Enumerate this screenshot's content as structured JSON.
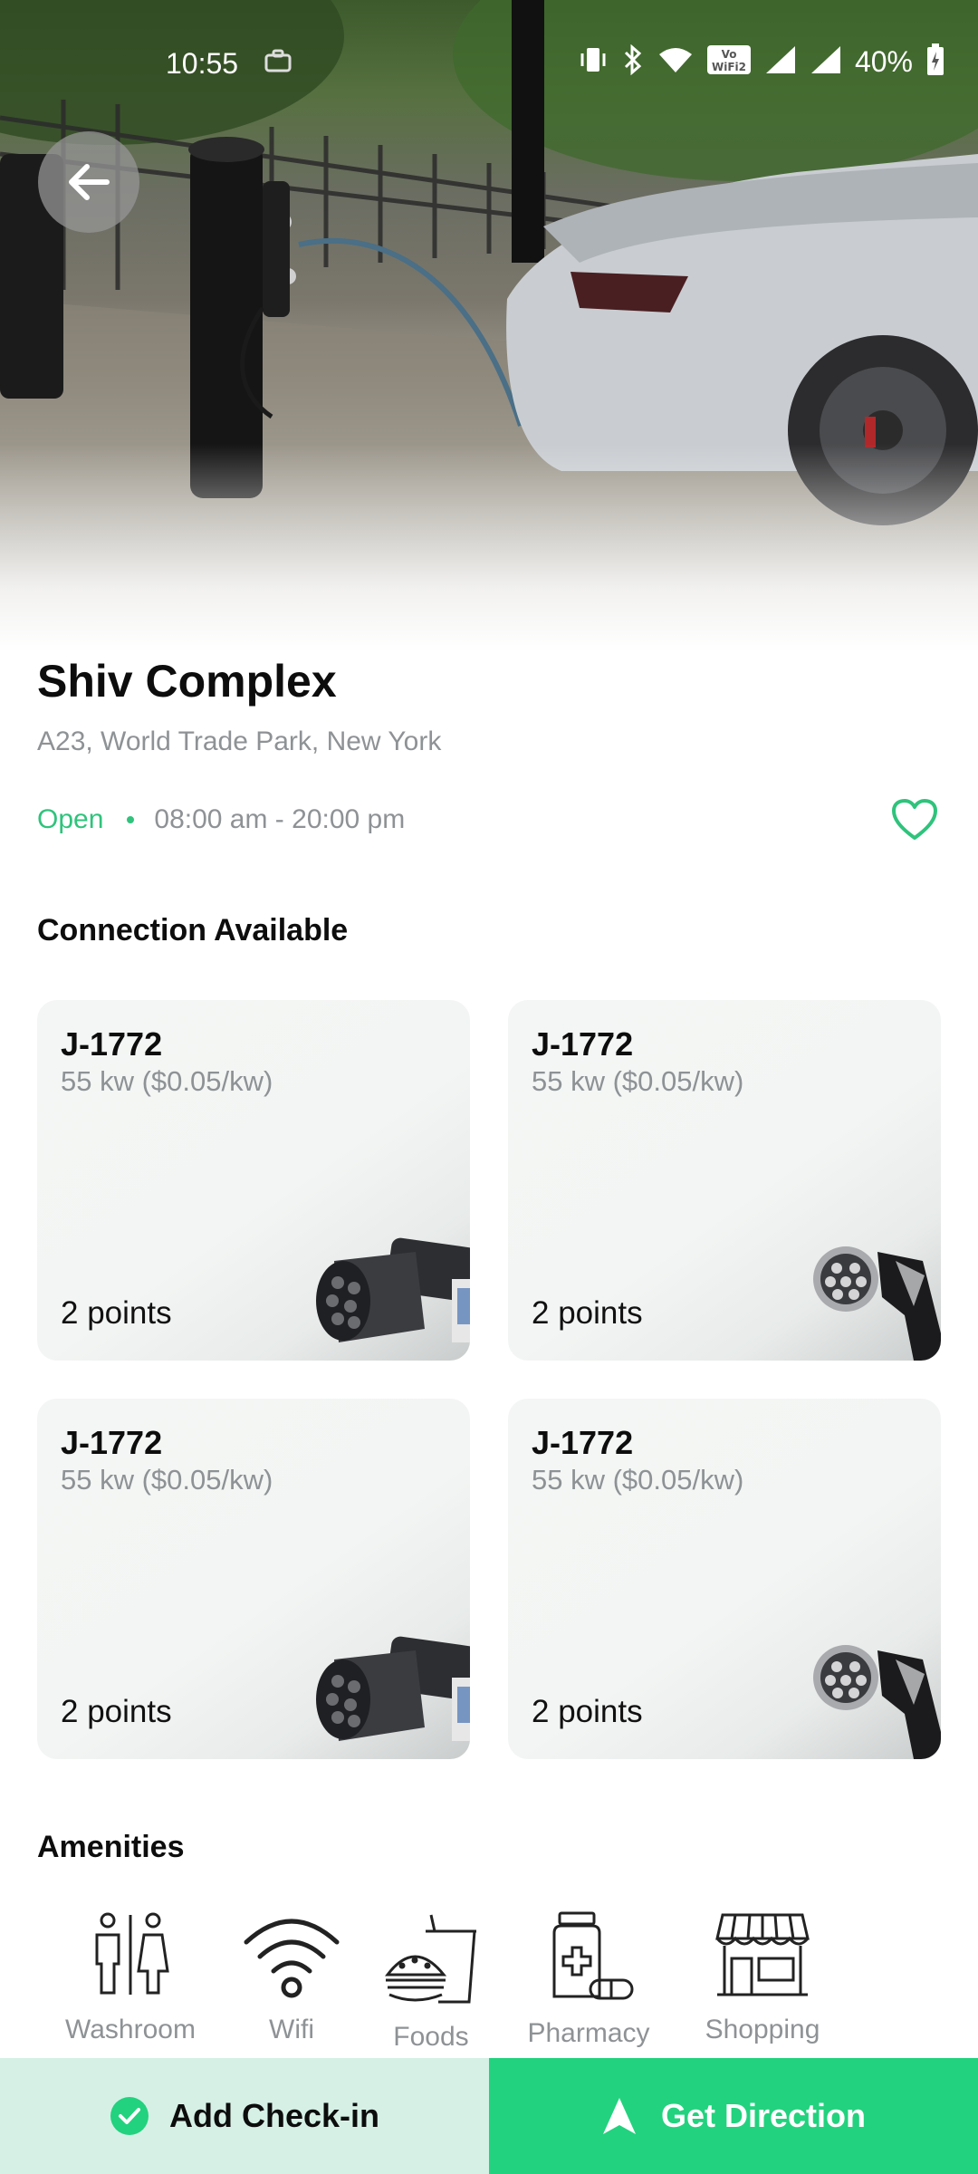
{
  "status_bar": {
    "time": "10:55",
    "battery": "40%"
  },
  "station": {
    "name": "Shiv Complex",
    "address": "A23, World Trade Park, New York",
    "status": "Open",
    "hours": "08:00 am - 20:00 pm"
  },
  "connections": {
    "heading": "Connection Available",
    "items": [
      {
        "name": "J-1772",
        "spec": "55 kw ($0.05/kw)",
        "points": "2 points",
        "plug_icon": "type2-plug-icon"
      },
      {
        "name": "J-1772",
        "spec": "55 kw ($0.05/kw)",
        "points": "2 points",
        "plug_icon": "ccs-plug-icon"
      },
      {
        "name": "J-1772",
        "spec": "55 kw ($0.05/kw)",
        "points": "2 points",
        "plug_icon": "type2-plug-icon"
      },
      {
        "name": "J-1772",
        "spec": "55 kw ($0.05/kw)",
        "points": "2 points",
        "plug_icon": "ccs-plug-icon"
      }
    ]
  },
  "amenities": {
    "heading": "Amenities",
    "items": [
      {
        "label": "Washroom",
        "icon": "washroom-icon"
      },
      {
        "label": "Wifi",
        "icon": "wifi-icon"
      },
      {
        "label": "Foods",
        "icon": "food-icon"
      },
      {
        "label": "Pharmacy",
        "icon": "pharmacy-icon"
      },
      {
        "label": "Shopping",
        "icon": "shop-icon"
      }
    ]
  },
  "actions": {
    "checkin_label": "Add Check-in",
    "direction_label": "Get Direction"
  },
  "colors": {
    "accent": "#22d27e",
    "open": "#2fc37c",
    "checkin_bg": "#d6f0e6",
    "muted_text": "#8e9295"
  }
}
